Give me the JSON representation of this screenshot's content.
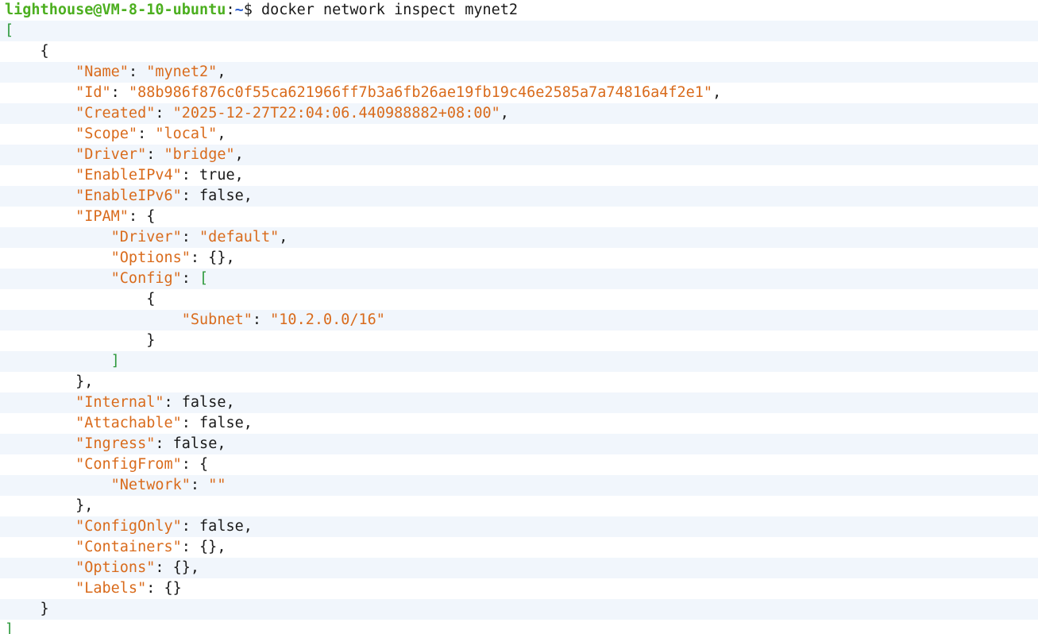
{
  "prompt": {
    "user_host": "lighthouse@VM-8-10-ubuntu",
    "colon": ":",
    "path": "~",
    "dollar": "$ ",
    "command": "docker network inspect mynet2"
  },
  "colors": {
    "key": "#d96b1c",
    "bracket_green": "#2f9a3e",
    "prompt_user": "#4caf1f",
    "prompt_path": "#2c5fd0",
    "band": "#f1f6fc"
  },
  "lines": [
    [
      [
        "g",
        "["
      ]
    ],
    [
      [
        "p",
        "    {"
      ]
    ],
    [
      [
        "p",
        "        "
      ],
      [
        "k",
        "\"Name\""
      ],
      [
        "p",
        ": "
      ],
      [
        "k",
        "\"mynet2\""
      ],
      [
        "p",
        ","
      ]
    ],
    [
      [
        "p",
        "        "
      ],
      [
        "k",
        "\"Id\""
      ],
      [
        "p",
        ": "
      ],
      [
        "k",
        "\"88b986f876c0f55ca621966ff7b3a6fb26ae19fb19c46e2585a7a74816a4f2e1\""
      ],
      [
        "p",
        ","
      ]
    ],
    [
      [
        "p",
        "        "
      ],
      [
        "k",
        "\"Created\""
      ],
      [
        "p",
        ": "
      ],
      [
        "k",
        "\"2025-12-27T22:04:06.440988882+08:00\""
      ],
      [
        "p",
        ","
      ]
    ],
    [
      [
        "p",
        "        "
      ],
      [
        "k",
        "\"Scope\""
      ],
      [
        "p",
        ": "
      ],
      [
        "k",
        "\"local\""
      ],
      [
        "p",
        ","
      ]
    ],
    [
      [
        "p",
        "        "
      ],
      [
        "k",
        "\"Driver\""
      ],
      [
        "p",
        ": "
      ],
      [
        "k",
        "\"bridge\""
      ],
      [
        "p",
        ","
      ]
    ],
    [
      [
        "p",
        "        "
      ],
      [
        "k",
        "\"EnableIPv4\""
      ],
      [
        "p",
        ": "
      ],
      [
        "v",
        "true"
      ],
      [
        "p",
        ","
      ]
    ],
    [
      [
        "p",
        "        "
      ],
      [
        "k",
        "\"EnableIPv6\""
      ],
      [
        "p",
        ": "
      ],
      [
        "v",
        "false"
      ],
      [
        "p",
        ","
      ]
    ],
    [
      [
        "p",
        "        "
      ],
      [
        "k",
        "\"IPAM\""
      ],
      [
        "p",
        ": {"
      ]
    ],
    [
      [
        "p",
        "            "
      ],
      [
        "k",
        "\"Driver\""
      ],
      [
        "p",
        ": "
      ],
      [
        "k",
        "\"default\""
      ],
      [
        "p",
        ","
      ]
    ],
    [
      [
        "p",
        "            "
      ],
      [
        "k",
        "\"Options\""
      ],
      [
        "p",
        ": {},"
      ]
    ],
    [
      [
        "p",
        "            "
      ],
      [
        "k",
        "\"Config\""
      ],
      [
        "p",
        ": "
      ],
      [
        "g",
        "["
      ]
    ],
    [
      [
        "p",
        "                {"
      ]
    ],
    [
      [
        "p",
        "                    "
      ],
      [
        "k",
        "\"Subnet\""
      ],
      [
        "p",
        ": "
      ],
      [
        "k",
        "\"10.2.0.0/16\""
      ]
    ],
    [
      [
        "p",
        "                }"
      ]
    ],
    [
      [
        "p",
        "            "
      ],
      [
        "g",
        "]"
      ]
    ],
    [
      [
        "p",
        "        },"
      ]
    ],
    [
      [
        "p",
        "        "
      ],
      [
        "k",
        "\"Internal\""
      ],
      [
        "p",
        ": "
      ],
      [
        "v",
        "false"
      ],
      [
        "p",
        ","
      ]
    ],
    [
      [
        "p",
        "        "
      ],
      [
        "k",
        "\"Attachable\""
      ],
      [
        "p",
        ": "
      ],
      [
        "v",
        "false"
      ],
      [
        "p",
        ","
      ]
    ],
    [
      [
        "p",
        "        "
      ],
      [
        "k",
        "\"Ingress\""
      ],
      [
        "p",
        ": "
      ],
      [
        "v",
        "false"
      ],
      [
        "p",
        ","
      ]
    ],
    [
      [
        "p",
        "        "
      ],
      [
        "k",
        "\"ConfigFrom\""
      ],
      [
        "p",
        ": {"
      ]
    ],
    [
      [
        "p",
        "            "
      ],
      [
        "k",
        "\"Network\""
      ],
      [
        "p",
        ": "
      ],
      [
        "k",
        "\"\""
      ]
    ],
    [
      [
        "p",
        "        },"
      ]
    ],
    [
      [
        "p",
        "        "
      ],
      [
        "k",
        "\"ConfigOnly\""
      ],
      [
        "p",
        ": "
      ],
      [
        "v",
        "false"
      ],
      [
        "p",
        ","
      ]
    ],
    [
      [
        "p",
        "        "
      ],
      [
        "k",
        "\"Containers\""
      ],
      [
        "p",
        ": {},"
      ]
    ],
    [
      [
        "p",
        "        "
      ],
      [
        "k",
        "\"Options\""
      ],
      [
        "p",
        ": {},"
      ]
    ],
    [
      [
        "p",
        "        "
      ],
      [
        "k",
        "\"Labels\""
      ],
      [
        "p",
        ": {}"
      ]
    ],
    [
      [
        "p",
        "    }"
      ]
    ],
    [
      [
        "g",
        "]"
      ]
    ]
  ]
}
